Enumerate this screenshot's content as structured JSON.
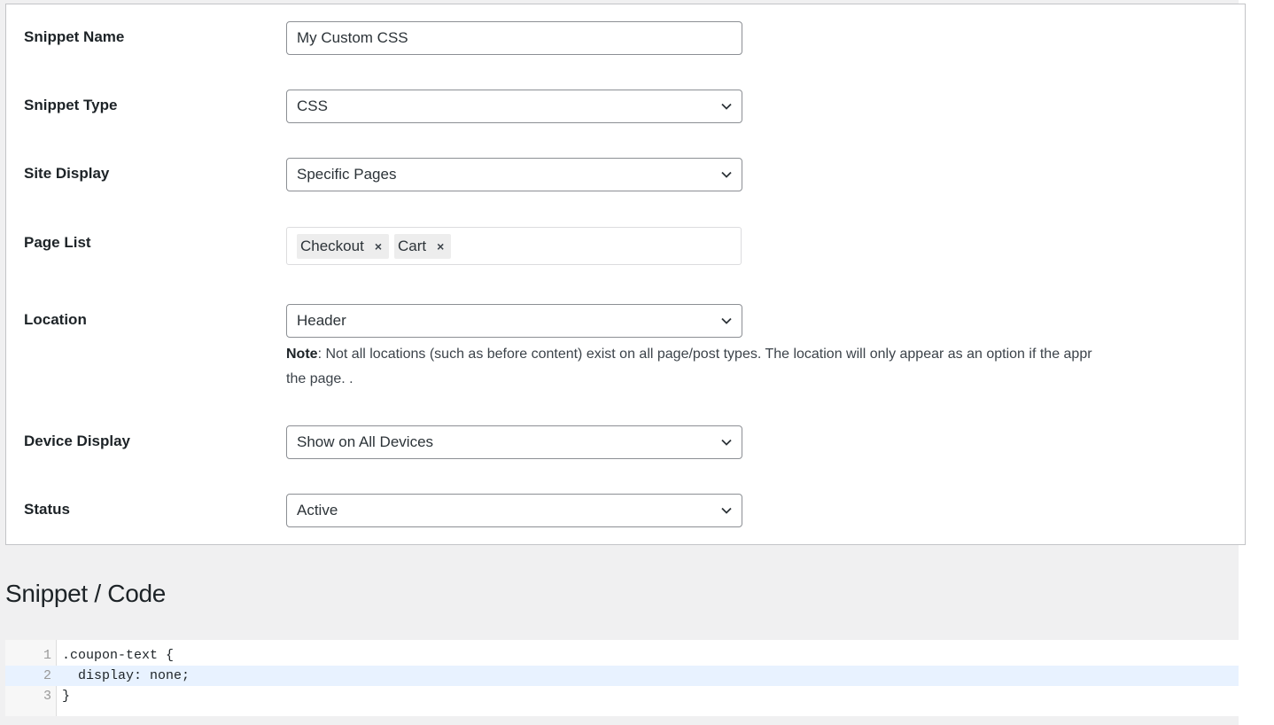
{
  "form": {
    "snippet_name": {
      "label": "Snippet Name",
      "value": "My Custom CSS"
    },
    "snippet_type": {
      "label": "Snippet Type",
      "value": "CSS"
    },
    "site_display": {
      "label": "Site Display",
      "value": "Specific Pages"
    },
    "page_list": {
      "label": "Page List",
      "tags": [
        "Checkout",
        "Cart"
      ],
      "remove_glyph": "×"
    },
    "location": {
      "label": "Location",
      "value": "Header",
      "note_prefix": "Note",
      "note_text": ": Not all locations (such as before content) exist on all page/post types. The location will only appear as an option if the appr",
      "note_text_line2": "the page. ."
    },
    "device_display": {
      "label": "Device Display",
      "value": "Show on All Devices"
    },
    "status": {
      "label": "Status",
      "value": "Active"
    }
  },
  "code_section": {
    "heading": "Snippet / Code",
    "lines": [
      {
        "number": "1",
        "text": ".coupon-text {"
      },
      {
        "number": "2",
        "text": "  display: none;"
      },
      {
        "number": "3",
        "text": "}"
      }
    ],
    "active_line": 2
  },
  "colors": {
    "page_background": "#f0f0f1",
    "panel_border": "#c3c4c7",
    "active_line": "#e8f2ff",
    "tag_background": "#ededed"
  },
  "icons": {
    "select_arrow": "chevron-down-icon",
    "tag_remove": "close-icon"
  }
}
